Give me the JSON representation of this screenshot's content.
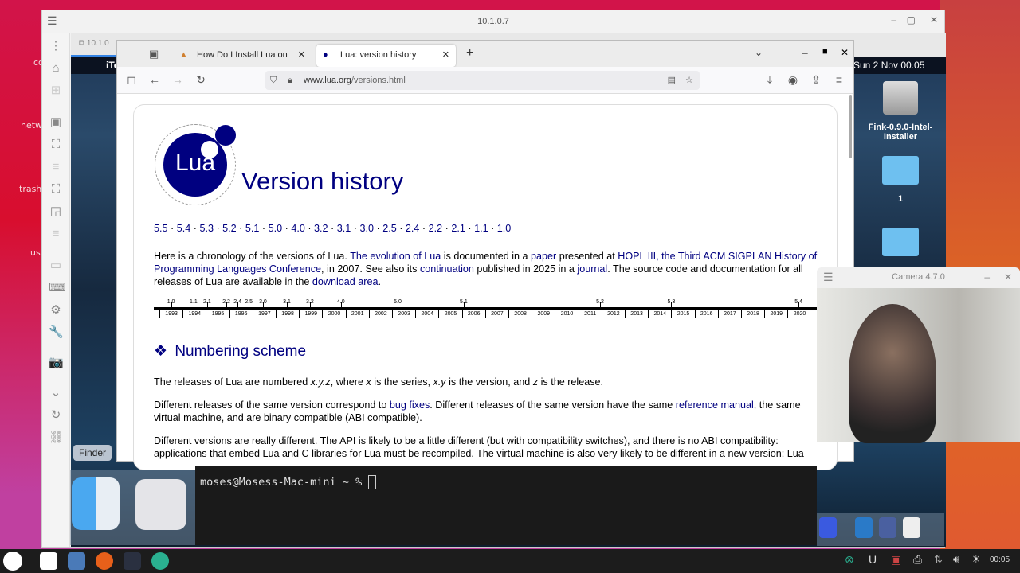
{
  "desktop": {
    "labels": [
      "co",
      "netw",
      "trash-",
      "us"
    ]
  },
  "remote": {
    "title": "10.1.0.7",
    "tab_label": "10.1.0",
    "mac_menu": {
      "app": "iTe",
      "clock": "Sun 2 Nov  00.05"
    },
    "desktop_icons": [
      {
        "label": "Fink-0.9.0-Intel-Installer",
        "icon": "drive-icon"
      },
      {
        "label": "1",
        "icon": "folder-icon"
      },
      {
        "label": "",
        "icon": "folder-icon"
      }
    ],
    "dock_tooltip": "Finder"
  },
  "browser": {
    "tabs": [
      {
        "label": "How Do I Install Lua on MacO",
        "active": false
      },
      {
        "label": "Lua: version history",
        "active": true
      }
    ],
    "url": {
      "host": "www.lua.org",
      "path": "/versions.html"
    },
    "page": {
      "logo_text": "Lua",
      "title": "Version history",
      "versions": [
        "5.5",
        "5.4",
        "5.3",
        "5.2",
        "5.1",
        "5.0",
        "4.0",
        "3.2",
        "3.1",
        "3.0",
        "2.5",
        "2.4",
        "2.2",
        "2.1",
        "1.1",
        "1.0"
      ],
      "intro": [
        {
          "t": "Here is a chronology of the versions of Lua. "
        },
        {
          "t": "The evolution of Lua",
          "link": true
        },
        {
          "t": " is documented in a "
        },
        {
          "t": "paper",
          "link": true
        },
        {
          "t": " presented at "
        },
        {
          "t": "HOPL III, the Third ACM SIGPLAN History of Programming Languages Conference",
          "link": true
        },
        {
          "t": ", in 2007. See also its "
        },
        {
          "t": "continuation",
          "link": true
        },
        {
          "t": " published in 2025 in a "
        },
        {
          "t": "journal",
          "link": true
        },
        {
          "t": ". The source code and documentation for all releases of Lua are available in the "
        },
        {
          "t": "download area",
          "link": true
        },
        {
          "t": "."
        }
      ],
      "timeline": {
        "years": [
          1993,
          1994,
          1995,
          1996,
          1997,
          1998,
          1999,
          2000,
          2001,
          2002,
          2003,
          2004,
          2005,
          2006,
          2007,
          2008,
          2009,
          2010,
          2011,
          2012,
          2013,
          2014,
          2015,
          2016,
          2017,
          2018,
          2019,
          2020
        ],
        "releases": [
          {
            "v": "1.0",
            "year": 1993.5
          },
          {
            "v": "1.1",
            "year": 1994.47
          },
          {
            "v": "2.1",
            "year": 1995.05
          },
          {
            "v": "2.2",
            "year": 1995.88
          },
          {
            "v": "2.4",
            "year": 1996.36
          },
          {
            "v": "2.5",
            "year": 1996.84
          },
          {
            "v": "3.0",
            "year": 1997.45
          },
          {
            "v": "3.1",
            "year": 1998.48
          },
          {
            "v": "3.2",
            "year": 1999.47
          },
          {
            "v": "4.0",
            "year": 2000.8
          },
          {
            "v": "5.0",
            "year": 2003.24
          },
          {
            "v": "5.1",
            "year": 2006.08
          },
          {
            "v": "5.2",
            "year": 2011.94
          },
          {
            "v": "5.3",
            "year": 2015.0
          },
          {
            "v": "5.4",
            "year": 2020.47
          }
        ]
      },
      "section_title": "Numbering scheme",
      "p1": [
        {
          "t": "The releases of Lua are numbered "
        },
        {
          "t": "x.y.z",
          "i": true
        },
        {
          "t": ", where "
        },
        {
          "t": "x",
          "i": true
        },
        {
          "t": " is the series, "
        },
        {
          "t": "x.y",
          "i": true
        },
        {
          "t": " is the version, and "
        },
        {
          "t": "z",
          "i": true
        },
        {
          "t": " is the release."
        }
      ],
      "p2": [
        {
          "t": "Different releases of the same version correspond to "
        },
        {
          "t": "bug fixes",
          "link": true
        },
        {
          "t": ". Different releases of the same version have the same "
        },
        {
          "t": "reference manual",
          "link": true
        },
        {
          "t": ", the same virtual machine, and are binary compatible (ABI compatible)."
        }
      ],
      "p3": [
        {
          "t": "Different versions are really different. The API is likely to be a little different (but with compatibility switches), and there is no ABI compatibility: applications that embed Lua and C libraries for Lua must be recompiled. The virtual machine is also very likely to be different in a new version: Lua"
        }
      ]
    }
  },
  "terminal": {
    "prompt": "moses@Mosess-Mac-mini ~ % "
  },
  "camera": {
    "title": "Camera 4.7.0"
  },
  "taskbar": {
    "clock": "00:05"
  }
}
